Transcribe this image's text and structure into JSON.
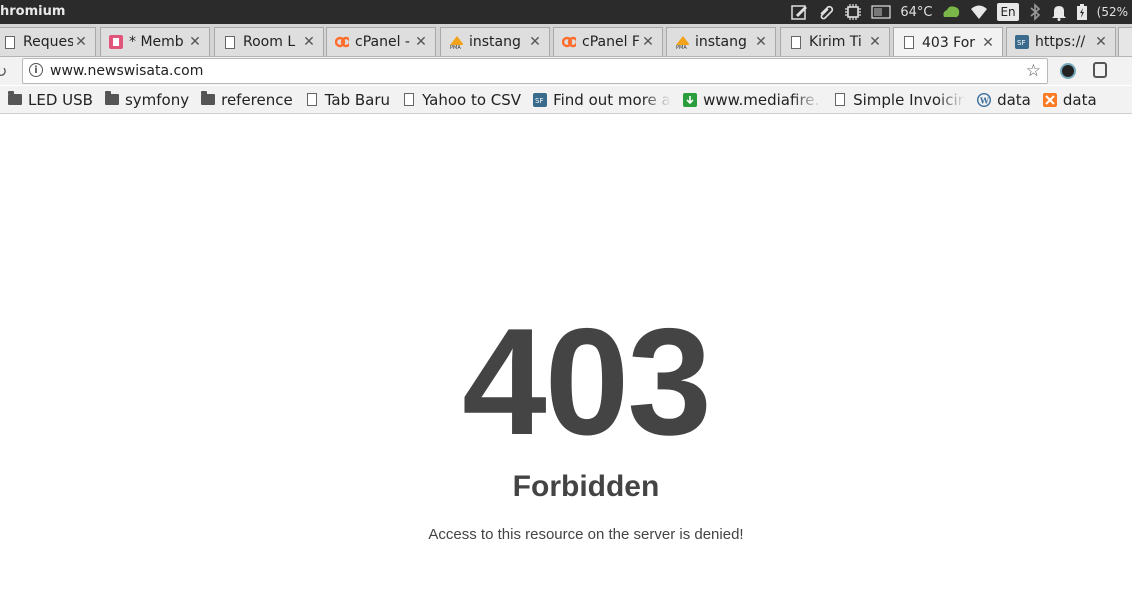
{
  "os": {
    "app_title": "hromium",
    "temperature": "64°C",
    "language": "En",
    "battery": "(52%"
  },
  "tabs": [
    {
      "title": "Request",
      "icon": "page-icon",
      "active": false
    },
    {
      "title": "* Memb",
      "icon": "pink-app-icon",
      "active": false
    },
    {
      "title": "Room L",
      "icon": "page-icon",
      "active": false
    },
    {
      "title": "cPanel -",
      "icon": "cpanel-icon",
      "active": false
    },
    {
      "title": "instang",
      "icon": "phpmyadmin-icon",
      "active": false
    },
    {
      "title": "cPanel F",
      "icon": "cpanel-icon",
      "active": false
    },
    {
      "title": "instang",
      "icon": "phpmyadmin-icon",
      "active": false
    },
    {
      "title": "Kirim Ti",
      "icon": "page-icon",
      "active": false
    },
    {
      "title": "403 For",
      "icon": "page-icon",
      "active": true
    },
    {
      "title": "https://",
      "icon": "sf-icon",
      "active": false
    }
  ],
  "toolbar": {
    "url": "www.newswisata.com"
  },
  "bookmarks": [
    {
      "label": "LED USB",
      "icon": "folder-icon"
    },
    {
      "label": "symfony",
      "icon": "folder-icon"
    },
    {
      "label": "reference",
      "icon": "folder-icon"
    },
    {
      "label": "Tab Baru",
      "icon": "page-icon"
    },
    {
      "label": "Yahoo to CSV",
      "icon": "page-icon"
    },
    {
      "label": "Find out more ab",
      "icon": "sf-icon"
    },
    {
      "label": "www.mediafire.c",
      "icon": "mediafire-icon"
    },
    {
      "label": "Simple Invoicing",
      "icon": "page-icon"
    },
    {
      "label": "data",
      "icon": "wordpress-icon"
    },
    {
      "label": "data",
      "icon": "xampp-icon"
    }
  ],
  "page": {
    "code": "403",
    "heading": "Forbidden",
    "message": "Access to this resource on the server is denied!"
  },
  "colors": {
    "os_bar": "#2b2b2b",
    "tab_strip": "#d4d4d4",
    "toolbar": "#f2f2f2",
    "error_text": "#444444"
  }
}
